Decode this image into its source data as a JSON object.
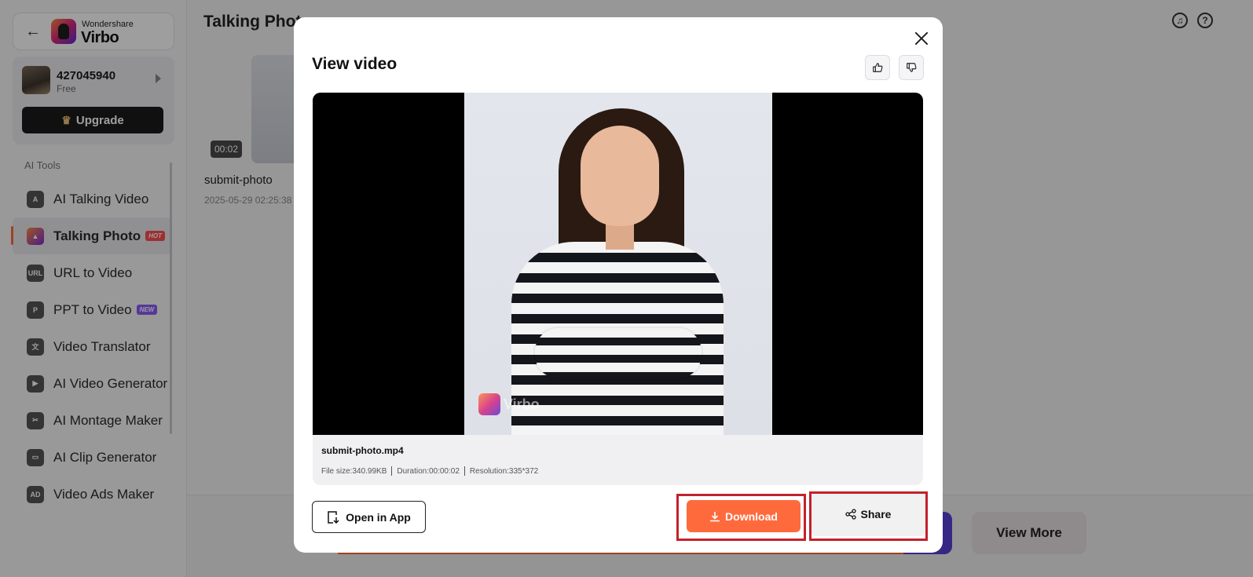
{
  "sidebar": {
    "brand_small": "Wondershare",
    "brand_big": "Virbo",
    "user": {
      "id": "427045940",
      "plan": "Free"
    },
    "upgrade_label": "Upgrade",
    "tools_label": "AI Tools",
    "items": [
      {
        "label": "AI Talking Video",
        "icon": "talking-video-icon",
        "glyph": "A"
      },
      {
        "label": "Talking Photo",
        "icon": "talking-photo-icon",
        "glyph": "▲",
        "badge": "HOT",
        "active": true
      },
      {
        "label": "URL to Video",
        "icon": "url-icon",
        "glyph": "URL"
      },
      {
        "label": "PPT to Video",
        "icon": "ppt-icon",
        "glyph": "P",
        "badge": "NEW"
      },
      {
        "label": "Video Translator",
        "icon": "translate-icon",
        "glyph": "文"
      },
      {
        "label": "AI Video Generator",
        "icon": "video-generator-icon",
        "glyph": "▶"
      },
      {
        "label": "AI Montage Maker",
        "icon": "montage-icon",
        "glyph": "✂"
      },
      {
        "label": "AI Clip Generator",
        "icon": "clip-icon",
        "glyph": "▭"
      },
      {
        "label": "Video Ads Maker",
        "icon": "ads-icon",
        "glyph": "AD"
      }
    ]
  },
  "main": {
    "title": "Talking Photo",
    "card": {
      "duration": "00:02",
      "name": "submit-photo",
      "date": "2025-05-29 02:25:38"
    },
    "view_more": "View More"
  },
  "modal": {
    "title": "View video",
    "file_name": "submit-photo.mp4",
    "file_size": "File size:340.99KB",
    "duration": "Duration:00:00:02",
    "resolution": "Resolution:335*372",
    "watermark": "Virbo",
    "open_in_app": "Open in App",
    "download": "Download",
    "share": "Share"
  },
  "colors": {
    "accent": "#ff6a3d",
    "highlight": "#c3212b",
    "primary_purple": "#5a3fd6"
  }
}
